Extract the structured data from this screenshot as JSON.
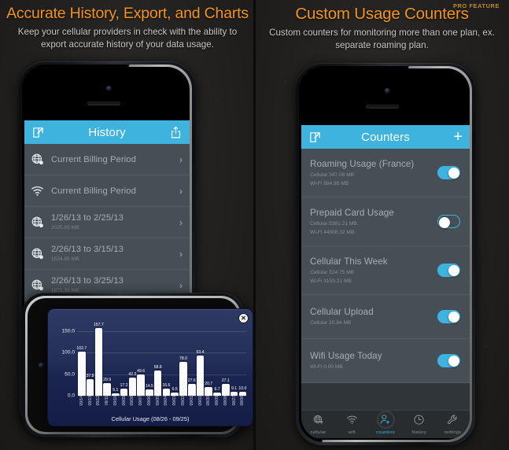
{
  "left_panel": {
    "heading": "Accurate History, Export, and Charts",
    "subheading": "Keep your cellular providers in check with the ability to export accurate history of your data usage.",
    "screen": {
      "navbar": {
        "title": "History",
        "compose_icon": "compose-icon",
        "share_icon": "share-icon"
      },
      "rows": [
        {
          "icon": "cellular-globe-icon",
          "title": "Current Billing Period",
          "detail": "",
          "chevron": "›"
        },
        {
          "icon": "wifi-icon",
          "title": "Current Billing Period",
          "detail": "",
          "chevron": "›"
        },
        {
          "icon": "cellular-globe-icon",
          "title": "1/26/13 to 2/25/13",
          "detail": "2025.05 MB",
          "chevron": "›"
        },
        {
          "icon": "cellular-globe-icon",
          "title": "2/26/13 to 3/15/13",
          "detail": "1524.85 MB",
          "chevron": "›"
        },
        {
          "icon": "cellular-globe-icon",
          "title": "2/26/13 to 3/25/13",
          "detail": "1971.36 MB",
          "chevron": "›"
        }
      ]
    },
    "chart_popup": {
      "close_label": "✕"
    }
  },
  "right_panel": {
    "pro_badge": "PRO FEATURE",
    "heading": "Custom Usage Counters",
    "subheading": "Custom counters for monitoring more than one plan, ex. separate roaming plan.",
    "screen": {
      "navbar": {
        "title": "Counters",
        "compose_icon": "compose-icon",
        "add_label": "+"
      },
      "counters": [
        {
          "name": "Roaming Usage (France)",
          "cellular": "Cellular  347.08 MB",
          "wifi": "Wi-Fi  884.98 MB",
          "enabled": true
        },
        {
          "name": "Prepaid Card Usage",
          "cellular": "Cellular  5381.21 MB",
          "wifi": "Wi-Fi  44008.32 MB",
          "enabled": false
        },
        {
          "name": "Cellular This Week",
          "cellular": "Cellular  324.75 MB",
          "wifi": "Wi-Fi  3103.21 MB",
          "enabled": true
        },
        {
          "name": "Cellular Upload",
          "cellular": "Cellular  20.84 MB",
          "wifi": "",
          "enabled": true
        },
        {
          "name": "Wifi Usage Today",
          "cellular": "Wi-Fi  0.00 MB",
          "wifi": "",
          "enabled": true
        }
      ],
      "tabs": [
        {
          "label": "cellular",
          "icon": "cellular-globe-icon",
          "active": false
        },
        {
          "label": "wifi",
          "icon": "wifi-icon",
          "active": false
        },
        {
          "label": "counters",
          "icon": "person-add-icon",
          "active": true
        },
        {
          "label": "history",
          "icon": "clock-icon",
          "active": false
        },
        {
          "label": "settings",
          "icon": "wrench-icon",
          "active": false
        }
      ]
    }
  },
  "colors": {
    "accent_orange": "#f2941f",
    "ios_blue": "#3eb3dd",
    "list_bg": "#454f55",
    "chart_bar": "#fbfbfb",
    "chart_bg": "#24305a"
  },
  "chart_data": {
    "type": "bar",
    "title": "",
    "xlabel": "Cellular Usage (08/26 - 09/25)",
    "ylabel": "",
    "ylim": [
      0,
      175
    ],
    "yticks": [
      "0.0",
      "50.0",
      "100.0",
      "150.0"
    ],
    "grid": true,
    "legend": "none",
    "categories": [
      "09/14",
      "09/13",
      "09/12",
      "09/11",
      "09/10",
      "09/09",
      "09/08",
      "09/07",
      "09/06",
      "09/05",
      "09/04",
      "09/03",
      "09/02",
      "09/01",
      "09/01",
      "08/30",
      "08/09",
      "08/08",
      "08/27",
      "08/06"
    ],
    "values": [
      102.7,
      37.8,
      157.7,
      29.9,
      5.1,
      17.2,
      42.3,
      49.6,
      14.5,
      58.8,
      16.6,
      6.5,
      78.0,
      27.6,
      93.4,
      20.7,
      6.7,
      27.1,
      9.1,
      10.0
    ],
    "value_labels": [
      "102.7",
      "37.8",
      "157.7",
      "29.9",
      "5.1",
      "17.2",
      "42.3",
      "49.6",
      "14.5",
      "58.8",
      "16.6",
      "6.5",
      "78.0",
      "27.6",
      "93.4",
      "20.7",
      "6.7",
      "27.1",
      "9.1",
      "10.0"
    ]
  }
}
